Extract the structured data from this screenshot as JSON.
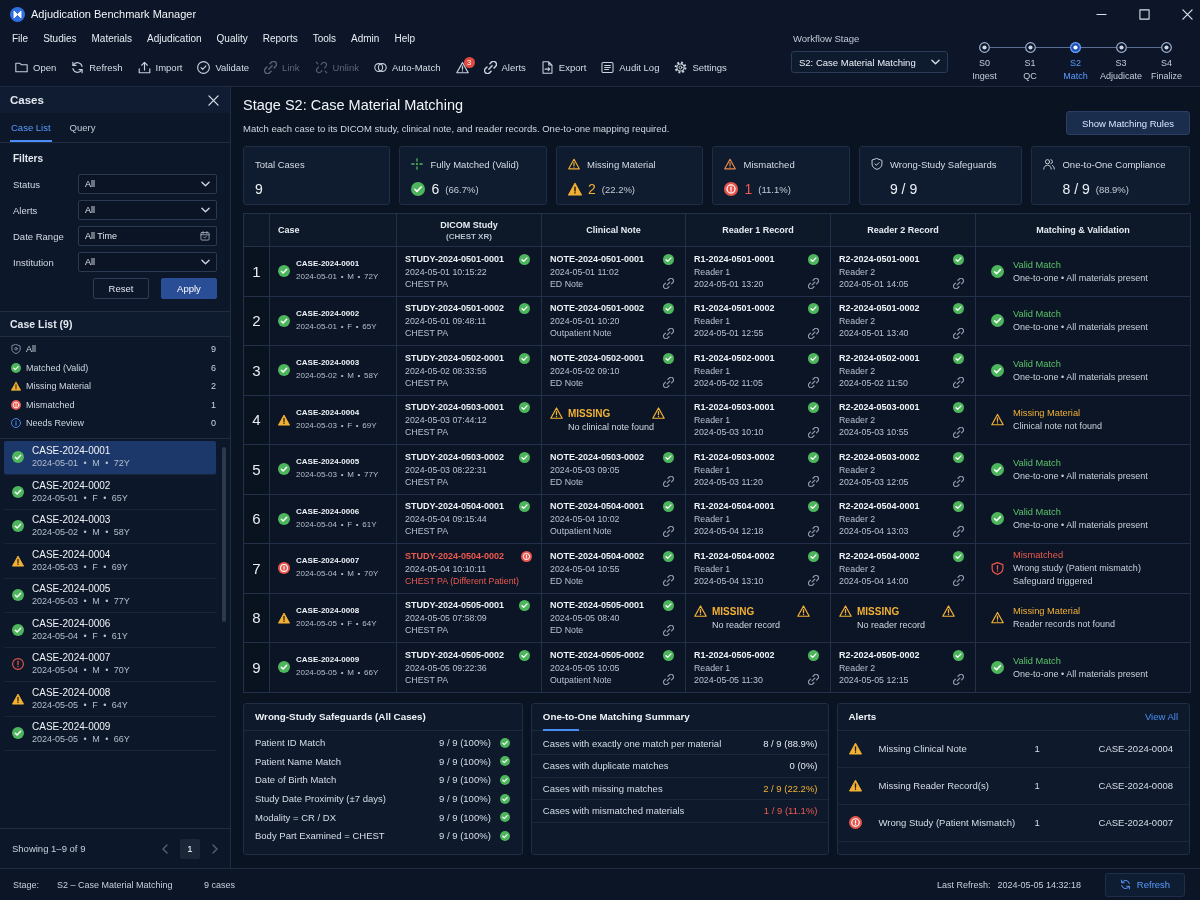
{
  "window": {
    "title": "Adjudication Benchmark Manager"
  },
  "menu": [
    "File",
    "Studies",
    "Materials",
    "Adjudication",
    "Quality",
    "Reports",
    "Tools",
    "Admin",
    "Help"
  ],
  "toolbar": [
    {
      "kind": "open",
      "label": "Open",
      "disabled": false
    },
    {
      "kind": "refresh",
      "label": "Refresh",
      "disabled": false
    },
    {
      "kind": "import",
      "label": "Import",
      "disabled": false
    },
    {
      "kind": "validate",
      "label": "Validate",
      "disabled": false
    },
    {
      "kind": "link",
      "label": "Link",
      "disabled": true
    },
    {
      "kind": "unlink",
      "label": "Unlink",
      "disabled": true
    },
    {
      "kind": "automatch",
      "label": "Auto-Match",
      "disabled": false
    },
    {
      "kind": "alertcount",
      "badge": "3",
      "disabled": false
    },
    {
      "kind": "alerts",
      "label": "Alerts",
      "disabled": false
    },
    {
      "kind": "export",
      "label": "Export",
      "disabled": false
    },
    {
      "kind": "auditlog",
      "label": "Audit Log",
      "disabled": false
    },
    {
      "kind": "settings",
      "label": "Settings",
      "disabled": false
    }
  ],
  "workflow": {
    "label": "Workflow Stage",
    "value": "S2: Case Material Matching",
    "steps": [
      {
        "code": "S0",
        "label": "Ingest",
        "selected": false
      },
      {
        "code": "S1",
        "label": "QC",
        "selected": false
      },
      {
        "code": "S2",
        "label": "Match",
        "selected": true
      },
      {
        "code": "S3",
        "label": "Adjudicate",
        "selected": false
      },
      {
        "code": "S4",
        "label": "Finalize",
        "selected": false
      }
    ]
  },
  "sidebar": {
    "title": "Cases",
    "tabs": [
      {
        "label": "Case List",
        "selected": true
      },
      {
        "label": "Query",
        "selected": false
      }
    ],
    "filters": {
      "title": "Filters",
      "fields": [
        {
          "kind": "select",
          "label": "Status",
          "value": "All"
        },
        {
          "kind": "select",
          "label": "Alerts",
          "value": "All"
        },
        {
          "kind": "date",
          "label": "Date Range",
          "value": "All Time"
        },
        {
          "kind": "select",
          "label": "Institution",
          "value": "All"
        }
      ],
      "buttons": [
        {
          "label": "Reset",
          "primary": false
        },
        {
          "label": "Apply",
          "primary": true
        }
      ]
    },
    "case_list": {
      "title": "Case List (9)",
      "categories": [
        {
          "kind": "all",
          "label": "All",
          "count": "9"
        },
        {
          "kind": "ok",
          "label": "Matched (Valid)",
          "count": "6"
        },
        {
          "kind": "missing",
          "label": "Missing Material",
          "count": "2"
        },
        {
          "kind": "mismatch",
          "label": "Mismatched",
          "count": "1"
        },
        {
          "kind": "review",
          "label": "Needs Review",
          "count": "0"
        }
      ],
      "items": [
        {
          "id": "CASE-2024-0001",
          "meta": "2024-05-01 • M • 72Y",
          "kind": "ok",
          "selected": true
        },
        {
          "id": "CASE-2024-0002",
          "meta": "2024-05-01 • F • 65Y",
          "kind": "ok",
          "selected": false
        },
        {
          "id": "CASE-2024-0003",
          "meta": "2024-05-02 • M • 58Y",
          "kind": "ok",
          "selected": false
        },
        {
          "id": "CASE-2024-0004",
          "meta": "2024-05-03 • F • 69Y",
          "kind": "missing",
          "selected": false
        },
        {
          "id": "CASE-2024-0005",
          "meta": "2024-05-03 • M • 77Y",
          "kind": "ok",
          "selected": false
        },
        {
          "id": "CASE-2024-0006",
          "meta": "2024-05-04 • F • 61Y",
          "kind": "ok",
          "selected": false
        },
        {
          "id": "CASE-2024-0007",
          "meta": "2024-05-04 • M • 70Y",
          "kind": "mismatch",
          "selected": false
        },
        {
          "id": "CASE-2024-0008",
          "meta": "2024-05-05 • F • 64Y",
          "kind": "missing",
          "selected": false
        },
        {
          "id": "CASE-2024-0009",
          "meta": "2024-05-05 • M • 66Y",
          "kind": "ok",
          "selected": false
        }
      ]
    },
    "footer": {
      "summary": "Showing 1–9 of 9",
      "pages": [
        {
          "label": "1",
          "selected": true
        }
      ]
    }
  },
  "header": {
    "title": "Stage S2: Case Material Matching",
    "subtitle": "Match each case to its DICOM study, clinical note, and reader records. One-to-one mapping required.",
    "button": "Show Matching Rules"
  },
  "cards": [
    {
      "kind": "count",
      "label": "Total Cases",
      "value": "9"
    },
    {
      "kind": "valid",
      "label": "Fully Matched (Valid)",
      "value": "6",
      "percent": "(66.7%)"
    },
    {
      "kind": "missing",
      "label": "Missing Material",
      "value": "2",
      "percent": "(22.2%)"
    },
    {
      "kind": "mismatch",
      "label": "Mismatched",
      "value": "1",
      "percent": "(11.1%)"
    },
    {
      "kind": "safeguard",
      "label": "Wrong-Study Safeguards",
      "value": "9 / 9"
    },
    {
      "kind": "compliance",
      "label": "One-to-One Compliance",
      "value": "8 / 9",
      "percent": "(88.9%)"
    }
  ],
  "table": {
    "columns": [
      {
        "label": "Case"
      },
      {
        "label": "DICOM Study",
        "sub": "(CHEST XR)"
      },
      {
        "label": "Clinical Note"
      },
      {
        "label": "Reader 1 Record"
      },
      {
        "label": "Reader 2 Record"
      },
      {
        "label": "Matching & Validation"
      }
    ],
    "rows": [
      {
        "number": "1",
        "case": {
          "id": "CASE-2024-0001",
          "meta": "2024-05-01 • M • 72Y",
          "kind": "ok"
        },
        "study": {
          "kind": "ok",
          "id": "STUDY-2024-0501-0001",
          "lines": [
            "2024-05-01 10:15:22",
            "CHEST PA"
          ]
        },
        "note": {
          "kind": "ok",
          "id": "NOTE-2024-0501-0001",
          "lines": [
            "2024-05-01 11:02",
            "ED Note"
          ],
          "linked": true
        },
        "reader_1": {
          "kind": "ok",
          "id": "R1-2024-0501-0001",
          "lines": [
            "Reader 1",
            "2024-05-01 13:20"
          ],
          "linked": true
        },
        "reader_2": {
          "kind": "ok",
          "id": "R2-2024-0501-0001",
          "lines": [
            "Reader 2",
            "2024-05-01 14:05"
          ],
          "linked": true
        },
        "validation": {
          "kind": "ok",
          "title": "Valid Match",
          "details": [
            "One-to-one • All materials present"
          ]
        }
      },
      {
        "number": "2",
        "case": {
          "id": "CASE-2024-0002",
          "meta": "2024-05-01 • F • 65Y",
          "kind": "ok"
        },
        "study": {
          "kind": "ok",
          "id": "STUDY-2024-0501-0002",
          "lines": [
            "2024-05-01 09:48:11",
            "CHEST PA"
          ]
        },
        "note": {
          "kind": "ok",
          "id": "NOTE-2024-0501-0002",
          "lines": [
            "2024-05-01 10:20",
            "Outpatient Note"
          ],
          "linked": true
        },
        "reader_1": {
          "kind": "ok",
          "id": "R1-2024-0501-0002",
          "lines": [
            "Reader 1",
            "2024-05-01 12:55"
          ],
          "linked": true
        },
        "reader_2": {
          "kind": "ok",
          "id": "R2-2024-0501-0002",
          "lines": [
            "Reader 2",
            "2024-05-01 13:40"
          ],
          "linked": true
        },
        "validation": {
          "kind": "ok",
          "title": "Valid Match",
          "details": [
            "One-to-one • All materials present"
          ]
        }
      },
      {
        "number": "3",
        "case": {
          "id": "CASE-2024-0003",
          "meta": "2024-05-02 • M • 58Y",
          "kind": "ok"
        },
        "study": {
          "kind": "ok",
          "id": "STUDY-2024-0502-0001",
          "lines": [
            "2024-05-02 08:33:55",
            "CHEST PA"
          ]
        },
        "note": {
          "kind": "ok",
          "id": "NOTE-2024-0502-0001",
          "lines": [
            "2024-05-02 09:10",
            "ED Note"
          ],
          "linked": true
        },
        "reader_1": {
          "kind": "ok",
          "id": "R1-2024-0502-0001",
          "lines": [
            "Reader 1",
            "2024-05-02 11:05"
          ],
          "linked": true
        },
        "reader_2": {
          "kind": "ok",
          "id": "R2-2024-0502-0001",
          "lines": [
            "Reader 2",
            "2024-05-02 11:50"
          ],
          "linked": true
        },
        "validation": {
          "kind": "ok",
          "title": "Valid Match",
          "details": [
            "One-to-one • All materials present"
          ]
        }
      },
      {
        "number": "4",
        "case": {
          "id": "CASE-2024-0004",
          "meta": "2024-05-03 • F • 69Y",
          "kind": "missing"
        },
        "study": {
          "kind": "ok",
          "id": "STUDY-2024-0503-0001",
          "lines": [
            "2024-05-03 07:44:12",
            "CHEST PA"
          ]
        },
        "note": {
          "kind": "missing",
          "label": "MISSING",
          "detail": "No clinical note found"
        },
        "reader_1": {
          "kind": "ok",
          "id": "R1-2024-0503-0001",
          "lines": [
            "Reader 1",
            "2024-05-03 10:10"
          ],
          "linked": true
        },
        "reader_2": {
          "kind": "ok",
          "id": "R2-2024-0503-0001",
          "lines": [
            "Reader 2",
            "2024-05-03 10:55"
          ],
          "linked": true
        },
        "validation": {
          "kind": "missing",
          "title": "Missing Material",
          "details": [
            "Clinical note not found"
          ]
        }
      },
      {
        "number": "5",
        "case": {
          "id": "CASE-2024-0005",
          "meta": "2024-05-03 • M • 77Y",
          "kind": "ok"
        },
        "study": {
          "kind": "ok",
          "id": "STUDY-2024-0503-0002",
          "lines": [
            "2024-05-03 08:22:31",
            "CHEST PA"
          ]
        },
        "note": {
          "kind": "ok",
          "id": "NOTE-2024-0503-0002",
          "lines": [
            "2024-05-03 09:05",
            "ED Note"
          ],
          "linked": true
        },
        "reader_1": {
          "kind": "ok",
          "id": "R1-2024-0503-0002",
          "lines": [
            "Reader 1",
            "2024-05-03 11:20"
          ],
          "linked": true
        },
        "reader_2": {
          "kind": "ok",
          "id": "R2-2024-0503-0002",
          "lines": [
            "Reader 2",
            "2024-05-03 12:05"
          ],
          "linked": true
        },
        "validation": {
          "kind": "ok",
          "title": "Valid Match",
          "details": [
            "One-to-one • All materials present"
          ]
        }
      },
      {
        "number": "6",
        "case": {
          "id": "CASE-2024-0006",
          "meta": "2024-05-04 • F • 61Y",
          "kind": "ok"
        },
        "study": {
          "kind": "ok",
          "id": "STUDY-2024-0504-0001",
          "lines": [
            "2024-05-04 09:15:44",
            "CHEST PA"
          ]
        },
        "note": {
          "kind": "ok",
          "id": "NOTE-2024-0504-0001",
          "lines": [
            "2024-05-04 10:02",
            "Outpatient Note"
          ],
          "linked": true
        },
        "reader_1": {
          "kind": "ok",
          "id": "R1-2024-0504-0001",
          "lines": [
            "Reader 1",
            "2024-05-04 12:18"
          ],
          "linked": true
        },
        "reader_2": {
          "kind": "ok",
          "id": "R2-2024-0504-0001",
          "lines": [
            "Reader 2",
            "2024-05-04 13:03"
          ],
          "linked": true
        },
        "validation": {
          "kind": "ok",
          "title": "Valid Match",
          "details": [
            "One-to-one • All materials present"
          ]
        }
      },
      {
        "number": "7",
        "case": {
          "id": "CASE-2024-0007",
          "meta": "2024-05-04 • M • 70Y",
          "kind": "mismatch"
        },
        "study": {
          "kind": "mismatch",
          "id": "STUDY-2024-0504-0002",
          "lines": [
            "2024-05-04 10:10:11",
            "CHEST PA (Different Patient)"
          ]
        },
        "note": {
          "kind": "ok",
          "id": "NOTE-2024-0504-0002",
          "lines": [
            "2024-05-04 10:55",
            "ED Note"
          ],
          "linked": true
        },
        "reader_1": {
          "kind": "ok",
          "id": "R1-2024-0504-0002",
          "lines": [
            "Reader 1",
            "2024-05-04 13:10"
          ],
          "linked": true
        },
        "reader_2": {
          "kind": "ok",
          "id": "R2-2024-0504-0002",
          "lines": [
            "Reader 2",
            "2024-05-04 14:00"
          ],
          "linked": true
        },
        "validation": {
          "kind": "mismatch",
          "title": "Mismatched",
          "details": [
            "Wrong study (Patient mismatch)",
            "Safeguard triggered"
          ]
        }
      },
      {
        "number": "8",
        "case": {
          "id": "CASE-2024-0008",
          "meta": "2024-05-05 • F • 64Y",
          "kind": "missing"
        },
        "study": {
          "kind": "ok",
          "id": "STUDY-2024-0505-0001",
          "lines": [
            "2024-05-05 07:58:09",
            "CHEST PA"
          ]
        },
        "note": {
          "kind": "ok",
          "id": "NOTE-2024-0505-0001",
          "lines": [
            "2024-05-05 08:40",
            "ED Note"
          ],
          "linked": true
        },
        "reader_1": {
          "kind": "missing",
          "label": "MISSING",
          "detail": "No reader record"
        },
        "reader_2": {
          "kind": "missing",
          "label": "MISSING",
          "detail": "No reader record"
        },
        "validation": {
          "kind": "missing",
          "title": "Missing Material",
          "details": [
            "Reader records not found"
          ]
        }
      },
      {
        "number": "9",
        "case": {
          "id": "CASE-2024-0009",
          "meta": "2024-05-05 • M • 66Y",
          "kind": "ok"
        },
        "study": {
          "kind": "ok",
          "id": "STUDY-2024-0505-0002",
          "lines": [
            "2024-05-05 09:22:36",
            "CHEST PA"
          ]
        },
        "note": {
          "kind": "ok",
          "id": "NOTE-2024-0505-0002",
          "lines": [
            "2024-05-05 10:05",
            "Outpatient Note"
          ],
          "linked": true
        },
        "reader_1": {
          "kind": "ok",
          "id": "R1-2024-0505-0002",
          "lines": [
            "Reader 1",
            "2024-05-05 11:30"
          ],
          "linked": true
        },
        "reader_2": {
          "kind": "ok",
          "id": "R2-2024-0505-0002",
          "lines": [
            "Reader 2",
            "2024-05-05 12:15"
          ],
          "linked": true
        },
        "validation": {
          "kind": "ok",
          "title": "Valid Match",
          "details": [
            "One-to-one • All materials present"
          ]
        }
      }
    ]
  },
  "safeguards": {
    "title": "Wrong-Study Safeguards (All Cases)",
    "rows": [
      {
        "label": "Patient ID Match",
        "value": "9 / 9 (100%)",
        "kind": "ok"
      },
      {
        "label": "Patient Name Match",
        "value": "9 / 9 (100%)",
        "kind": "ok"
      },
      {
        "label": "Date of Birth Match",
        "value": "9 / 9 (100%)",
        "kind": "ok"
      },
      {
        "label": "Study Date Proximity (±7 days)",
        "value": "9 / 9 (100%)",
        "kind": "ok"
      },
      {
        "label": "Modality = CR / DX",
        "value": "9 / 9 (100%)",
        "kind": "ok"
      },
      {
        "label": "Body Part Examined = CHEST",
        "value": "9 / 9 (100%)",
        "kind": "ok"
      }
    ]
  },
  "matching_summary": {
    "title": "One-to-One Matching Summary",
    "rows": [
      {
        "label": "Cases with exactly one match per material",
        "value": "8 / 9 (88.9%)",
        "kind": "neutral"
      },
      {
        "label": "Cases with duplicate matches",
        "value": "0 (0%)",
        "kind": "neutral"
      },
      {
        "label": "Cases with missing matches",
        "value": "2 / 9 (22.2%)",
        "kind": "missing"
      },
      {
        "label": "Cases with mismatched materials",
        "value": "1 / 9 (11.1%)",
        "kind": "mismatch"
      }
    ]
  },
  "alerts": {
    "title": "Alerts",
    "action": "View All",
    "items": [
      {
        "kind": "missing",
        "label": "Missing Clinical Note",
        "count": "1",
        "case": "CASE-2024-0004"
      },
      {
        "kind": "missing",
        "label": "Missing Reader Record(s)",
        "count": "1",
        "case": "CASE-2024-0008"
      },
      {
        "kind": "mismatch",
        "label": "Wrong Study (Patient Mismatch)",
        "count": "1",
        "case": "CASE-2024-0007"
      }
    ]
  },
  "status_bar": {
    "stage_label": "Stage:",
    "stage": "S2 – Case Material Matching",
    "count": "9 cases",
    "refresh_label": "Last Refresh:",
    "refresh_time": "2024-05-05 14:32:18",
    "button": "Refresh"
  }
}
